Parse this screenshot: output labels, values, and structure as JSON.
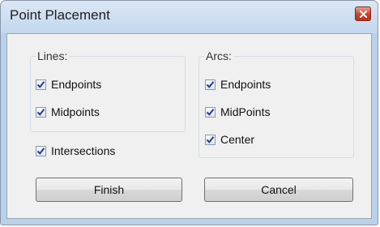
{
  "window": {
    "title": "Point Placement",
    "close_icon": "close-icon"
  },
  "lines_group": {
    "label": "Lines:",
    "options": [
      {
        "label": "Endpoints",
        "checked": true
      },
      {
        "label": "Midpoints",
        "checked": true
      }
    ]
  },
  "arcs_group": {
    "label": "Arcs:",
    "options": [
      {
        "label": "Endpoints",
        "checked": true
      },
      {
        "label": "MidPoints",
        "checked": true
      },
      {
        "label": "Center",
        "checked": true
      }
    ]
  },
  "intersections": {
    "label": "Intersections",
    "checked": true
  },
  "buttons": {
    "finish": "Finish",
    "cancel": "Cancel"
  },
  "colors": {
    "check_mark": "#2b3a8c",
    "close_button": "#c7412a"
  }
}
